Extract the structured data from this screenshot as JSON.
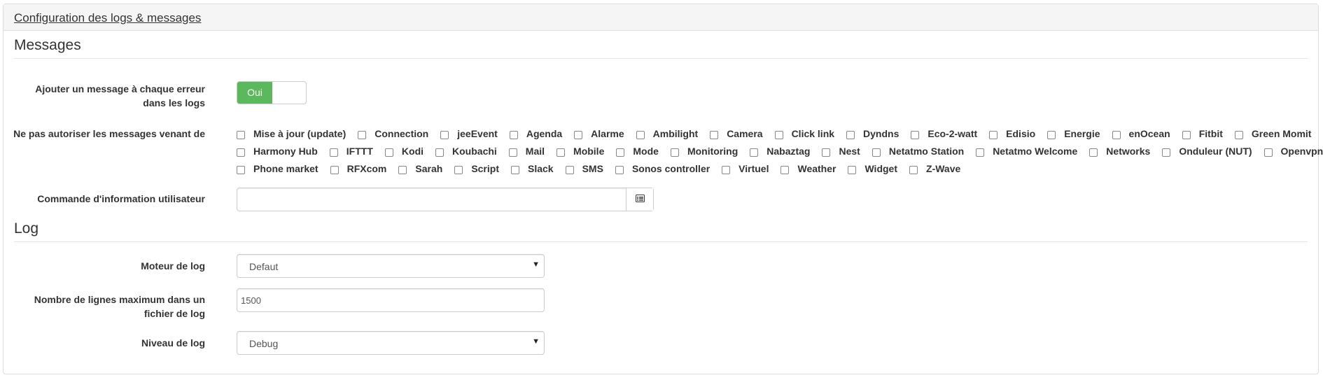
{
  "panel": {
    "title": "Configuration des logs & messages"
  },
  "messages": {
    "legend": "Messages",
    "add_error_label": "Ajouter un message à chaque erreur dans les logs",
    "toggle_label": "Oui",
    "toggle_color": "#5cb85c",
    "block_label": "Ne pas autoriser les messages venant de",
    "block_rows": [
      [
        "Mise à jour (update)",
        "Connection",
        "jeeEvent",
        "Agenda",
        "Alarme",
        "Ambilight",
        "Camera",
        "Click link",
        "Dyndns",
        "Eco-2-watt",
        "Edisio",
        "Energie",
        "enOcean",
        "Fitbit",
        "Green Momit"
      ],
      [
        "Harmony Hub",
        "IFTTT",
        "Kodi",
        "Koubachi",
        "Mail",
        "Mobile",
        "Mode",
        "Monitoring",
        "Nabaztag",
        "Nest",
        "Netatmo Station",
        "Netatmo Welcome",
        "Networks",
        "Onduleur (NUT)",
        "Openvpn"
      ],
      [
        "Phone market",
        "RFXcom",
        "Sarah",
        "Script",
        "Slack",
        "SMS",
        "Sonos controller",
        "Virtuel",
        "Weather",
        "Widget",
        "Z-Wave"
      ]
    ],
    "user_cmd_label": "Commande d'information utilisateur",
    "user_cmd_value": ""
  },
  "log": {
    "legend": "Log",
    "engine_label": "Moteur de log",
    "engine_value": "Defaut",
    "maxlines_label": "Nombre de lignes maximum dans un fichier de log",
    "maxlines_value": "1500",
    "level_label": "Niveau de log",
    "level_value": "Debug"
  }
}
